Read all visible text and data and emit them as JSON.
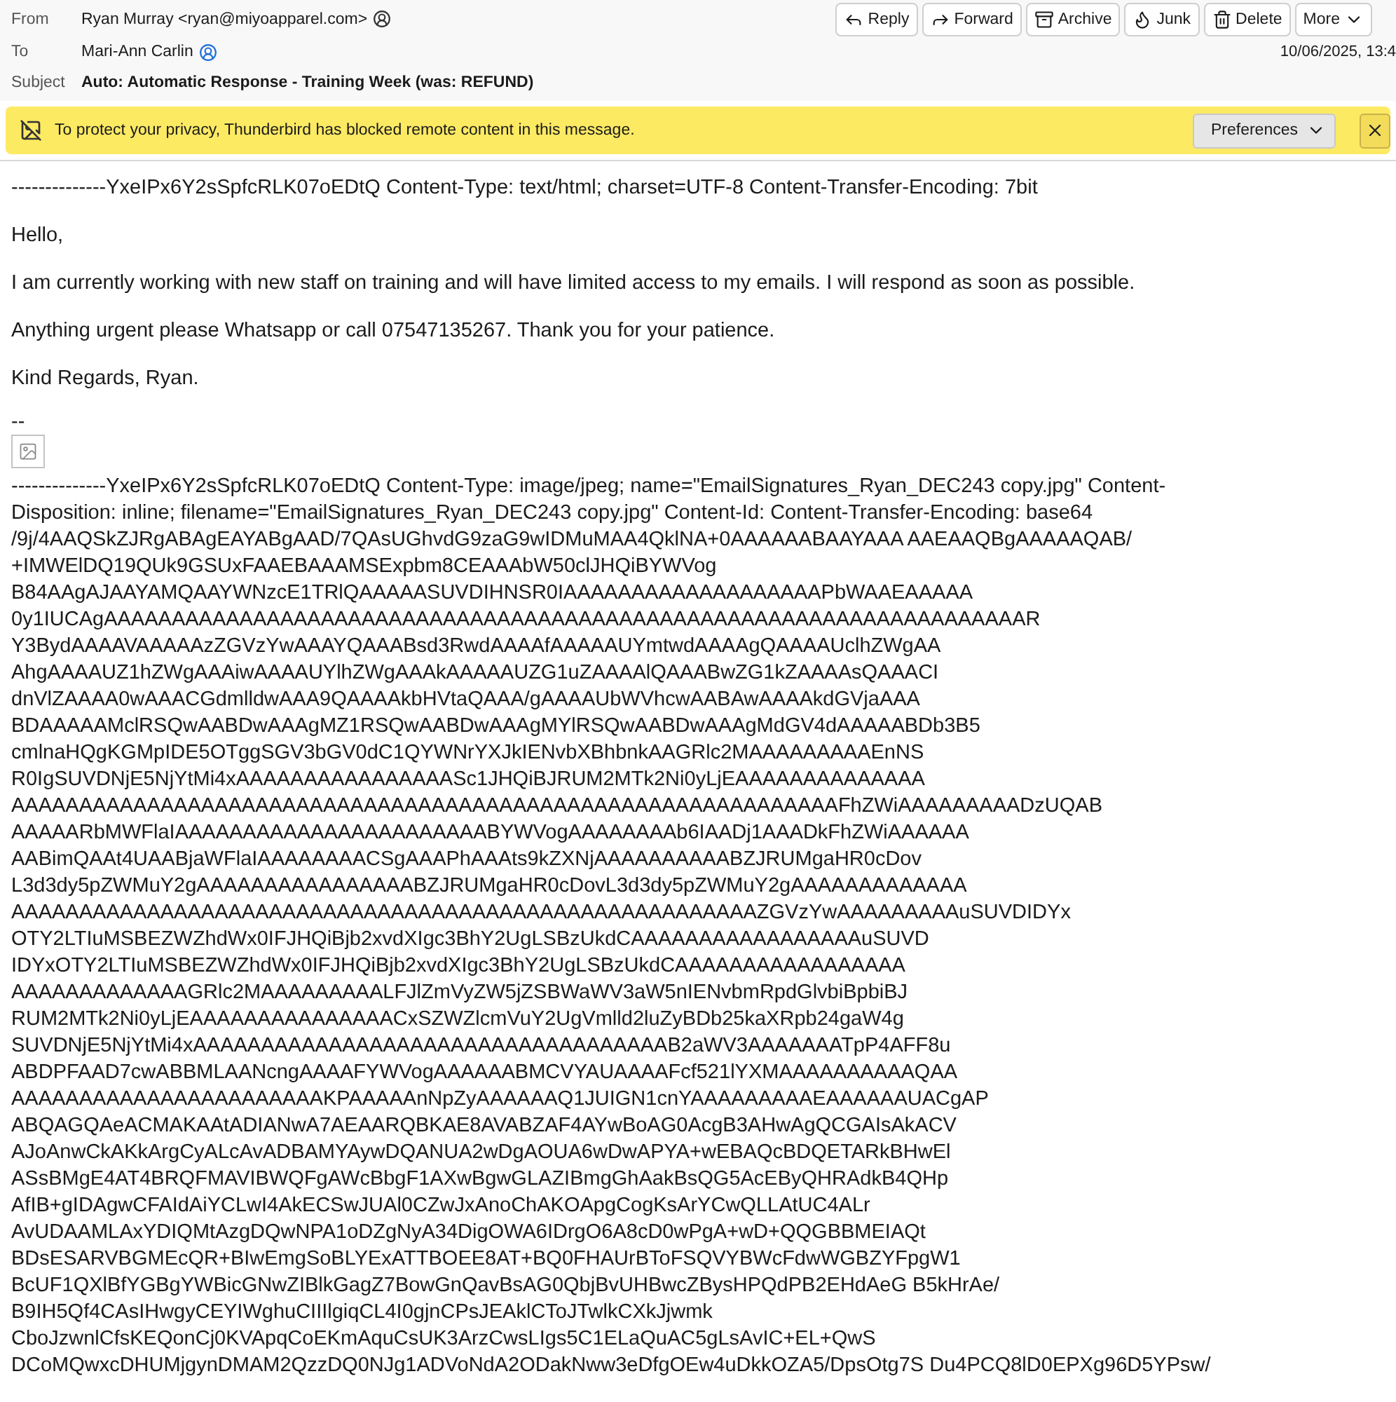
{
  "header": {
    "from_label": "From",
    "from": "Ryan Murray <ryan@miyoapparel.com>",
    "to_label": "To",
    "to": "Mari-Ann Carlin",
    "subject_label": "Subject",
    "subject": "Auto: Automatic Response - Training Week (was: REFUND)",
    "date": "10/06/2025, 13:4",
    "actions": [
      {
        "kind": "reply",
        "label": "Reply"
      },
      {
        "kind": "forward",
        "label": "Forward"
      },
      {
        "kind": "archive",
        "label": "Archive"
      },
      {
        "kind": "junk",
        "label": "Junk"
      },
      {
        "kind": "delete",
        "label": "Delete"
      },
      {
        "kind": "more",
        "label": "More"
      }
    ]
  },
  "notification": {
    "text": "To protect your privacy, Thunderbird has blocked remote content in this message.",
    "button": "Preferences"
  },
  "body": {
    "boundary": "--------------YxeIPx6Y2sSpfcRLK07oEDtQ Content-Type: text/html; charset=UTF-8 Content-Transfer-Encoding: 7bit",
    "paragraphs": [
      "Hello,",
      "I am currently working with new staff on training and will have limited access to my emails. I will respond as soon as possible.",
      "Anything urgent please Whatsapp or call 07547135267. Thank you for your patience.",
      "Kind Regards, Ryan."
    ],
    "signature_separator": "--",
    "attachment_lines": [
      "--------------YxeIPx6Y2sSpfcRLK07oEDtQ Content-Type: image/jpeg; name=\"EmailSignatures_Ryan_DEC243 copy.jpg\" Content-",
      "Disposition: inline; filename=\"EmailSignatures_Ryan_DEC243 copy.jpg\" Content-Id: Content-Transfer-Encoding: base64",
      "/9j/4AAQSkZJRgABAgEAYABgAAD/7QAsUGhvdG9zaG9wIDMuMAA4QklNA+0AAAAAABAAYAAA AAEAAQBgAAAAAQAB/",
      "+IMWElDQ19QUk9GSUxFAAEBAAAMSExpbm8CEAAAbW50clJHQiBYWVog",
      "B84AAgAJAAYAMQAAYWNzcE1TRlQAAAAASUVDIHNSR0IAAAAAAAAAAAAAAAAAAAPbWAAEAAAAA",
      "0y1IUCAgAAAAAAAAAAAAAAAAAAAAAAAAAAAAAAAAAAAAAAAAAAAAAAAAAAAAAAAAAAAAAAAAAAAAR",
      "Y3BydAAAAVAAAAAzZGVzYwAAAYQAAABsd3RwdAAAAfAAAAAUYmtwdAAAAgQAAAAUclhZWgAA",
      "AhgAAAAUZ1hZWgAAAiwAAAAUYlhZWgAAAkAAAAAUZG1uZAAAAlQAAABwZG1kZAAAAsQAAACI",
      "dnVlZAAAA0wAAACGdmlldwAAA9QAAAAkbHVtaQAAA/gAAAAUbWVhcwAABAwAAAAkdGVjaAAA",
      "BDAAAAAMclRSQwAABDwAAAgMZ1RSQwAABDwAAAgMYlRSQwAABDwAAAgMdGV4dAAAAABDb3B5",
      "cmlnaHQgKGMpIDE5OTggSGV3bGV0dC1QYWNrYXJkIENvbXBhbnkAAGRlc2MAAAAAAAAAEnNS",
      "R0IgSUVDNjE5NjYtMi4xAAAAAAAAAAAAAAAASc1JHQiBJRUM2MTk2Ni0yLjEAAAAAAAAAAAAAA",
      "AAAAAAAAAAAAAAAAAAAAAAAAAAAAAAAAAAAAAAAAAAAAAAAAAAAAAAAAAAAAAFhZWiAAAAAAAAADzUQAB",
      "AAAAARbMWFlaIAAAAAAAAAAAAAAAAAAAAAAABYWVogAAAAAAAAb6IAADj1AAADkFhZWiAAAAAA",
      "AABimQAAt4UAABjaWFlaIAAAAAAAACSgAAAPhAAAts9kZXNjAAAAAAAAAABZJRUMgaHR0cDov",
      "L3d3dy5pZWMuY2gAAAAAAAAAAAAAAAABZJRUMgaHR0cDovL3d3dy5pZWMuY2gAAAAAAAAAAAAA",
      "AAAAAAAAAAAAAAAAAAAAAAAAAAAAAAAAAAAAAAAAAAAAAAAAAAAAAAAZGVzYwAAAAAAAAAuSUVDIDYx",
      "OTY2LTIuMSBEZWZhdWx0IFJHQiBjb2xvdXIgc3BhY2UgLSBzUkdCAAAAAAAAAAAAAAAAAuSUVD",
      "IDYxOTY2LTIuMSBEZWZhdWx0IFJHQiBjb2xvdXIgc3BhY2UgLSBzUkdCAAAAAAAAAAAAAAAAA",
      "AAAAAAAAAAAAAGRlc2MAAAAAAAAALFJlZmVyZW5jZSBWaWV3aW5nIENvbmRpdGlvbiBpbiBJ",
      "RUM2MTk2Ni0yLjEAAAAAAAAAAAAAAACxSZWZlcmVuY2UgVmlld2luZyBDb25kaXRpb24gaW4g",
      "SUVDNjE5NjYtMi4xAAAAAAAAAAAAAAAAAAAAAAAAAAAAAAAAAAAB2aWV3AAAAAAATpP4AFF8u",
      "ABDPFAAD7cwABBMLAANcngAAAAFYWVogAAAAAABMCVYAUAAAAFcf521lYXMAAAAAAAAAAQAA",
      "AAAAAAAAAAAAAAAAAAAAAAAKPAAAAAnNpZyAAAAAAQ1JUIGN1cnYAAAAAAAAAEAAAAAAUACgAP",
      "ABQAGQAeACMAKAAtADIANwA7AEAARQBKAE8AVABZAF4AYwBoAG0AcgB3AHwAgQCGAIsAkACV",
      "AJoAnwCkAKkArgCyALcAvADBAMYAywDQANUA2wDgAOUA6wDwAPYA+wEBAQcBDQETARkBHwEl",
      "ASsBMgE4AT4BRQFMAVIBWQFgAWcBbgF1AXwBgwGLAZIBmgGhAakBsQG5AcEByQHRAdkB4QHp",
      "AfIB+gIDAgwCFAIdAiYCLwI4AkECSwJUAl0CZwJxAnoChAKOApgCogKsArYCwQLLAtUC4ALr",
      "AvUDAAMLAxYDIQMtAzgDQwNPA1oDZgNyA34DigOWA6IDrgO6A8cD0wPgA+wD+QQGBBMEIAQt",
      "BDsESARVBGMEcQR+BIwEmgSoBLYExATTBOEE8AT+BQ0FHAUrBToFSQVYBWcFdwWGBZYFpgW1",
      "BcUF1QXlBfYGBgYWBicGNwZIBlkGagZ7BowGnQavBsAG0QbjBvUHBwcZBysHPQdPB2EHdAeG B5kHrAe/",
      "B9IH5Qf4CAsIHwgyCEYIWghuCIIIlgiqCL4I0gjnCPsJEAklCToJTwlkCXkJjwmk",
      "CboJzwnlCfsKEQonCj0KVApqCoEKmAquCsUK3ArzCwsLIgs5C1ELaQuAC5gLsAvIC+EL+QwS",
      "DCoMQwxcDHUMjgynDMAM2QzzDQ0NJg1ADVoNdA2ODakNww3eDfgOEw4uDkkOZA5/DpsOtg7S Du4PCQ8lD0EPXg96D5YPsw/"
    ]
  }
}
